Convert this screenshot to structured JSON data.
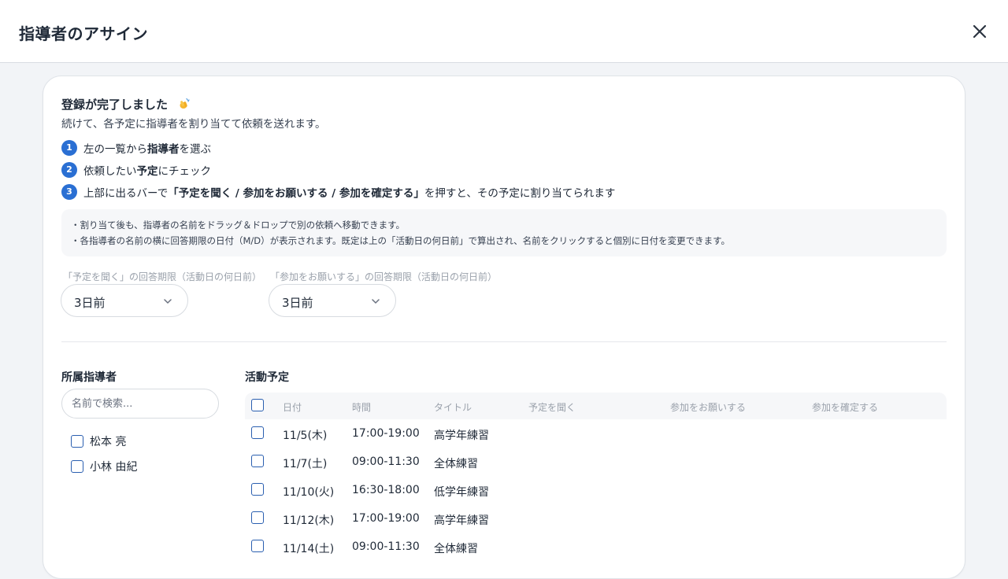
{
  "header": {
    "title": "指導者のアサイン",
    "close_icon": "close-icon"
  },
  "intro": {
    "title": "登録が完了しました",
    "title_icon": "clapping-hands-icon",
    "subtitle": "続けて、各予定に指導者を割り当てて依頼を送れます。"
  },
  "steps": [
    {
      "num": "1",
      "pre": "左の一覧から",
      "bold": "指導者",
      "post": "を選ぶ"
    },
    {
      "num": "2",
      "pre": "依頼したい",
      "bold": "予定",
      "post": "にチェック"
    },
    {
      "num": "3",
      "pre": "上部に出るバーで",
      "bold": "「予定を聞く / 参加をお願いする / 参加を確定する」",
      "post": "を押すと、その予定に割り当てられます"
    }
  ],
  "notes": [
    "・割り当て後も、指導者の名前をドラッグ＆ドロップで別の依頼へ移動できます。",
    "・各指導者の名前の横に回答期限の日付（M/D）が表示されます。既定は上の「活動日の何日前」で算出され、名前をクリックすると個別に日付を変更できます。"
  ],
  "deadlines": {
    "ask": {
      "label": "「予定を聞く」の回答期限（活動日の何日前）",
      "value": "3日前"
    },
    "request": {
      "label": "「参加をお願いする」の回答期限（活動日の何日前）",
      "value": "3日前"
    }
  },
  "coaches": {
    "title": "所属指導者",
    "search_placeholder": "名前で検索...",
    "items": [
      "松本 亮",
      "小林 由紀"
    ]
  },
  "schedule": {
    "title": "活動予定",
    "columns": [
      "日付",
      "時間",
      "タイトル",
      "予定を聞く",
      "参加をお願いする",
      "参加を確定する"
    ],
    "rows": [
      {
        "date": "11/5(木)",
        "time": "17:00-19:00",
        "title": "高学年練習"
      },
      {
        "date": "11/7(土)",
        "time": "09:00-11:30",
        "title": "全体練習"
      },
      {
        "date": "11/10(火)",
        "time": "16:30-18:00",
        "title": "低学年練習"
      },
      {
        "date": "11/12(木)",
        "time": "17:00-19:00",
        "title": "高学年練習"
      },
      {
        "date": "11/14(土)",
        "time": "09:00-11:30",
        "title": "全体練習"
      }
    ]
  },
  "colors": {
    "accent": "#2a6fd3",
    "checkbox_border": "#2a5fb0",
    "background": "#f2f4f7"
  }
}
